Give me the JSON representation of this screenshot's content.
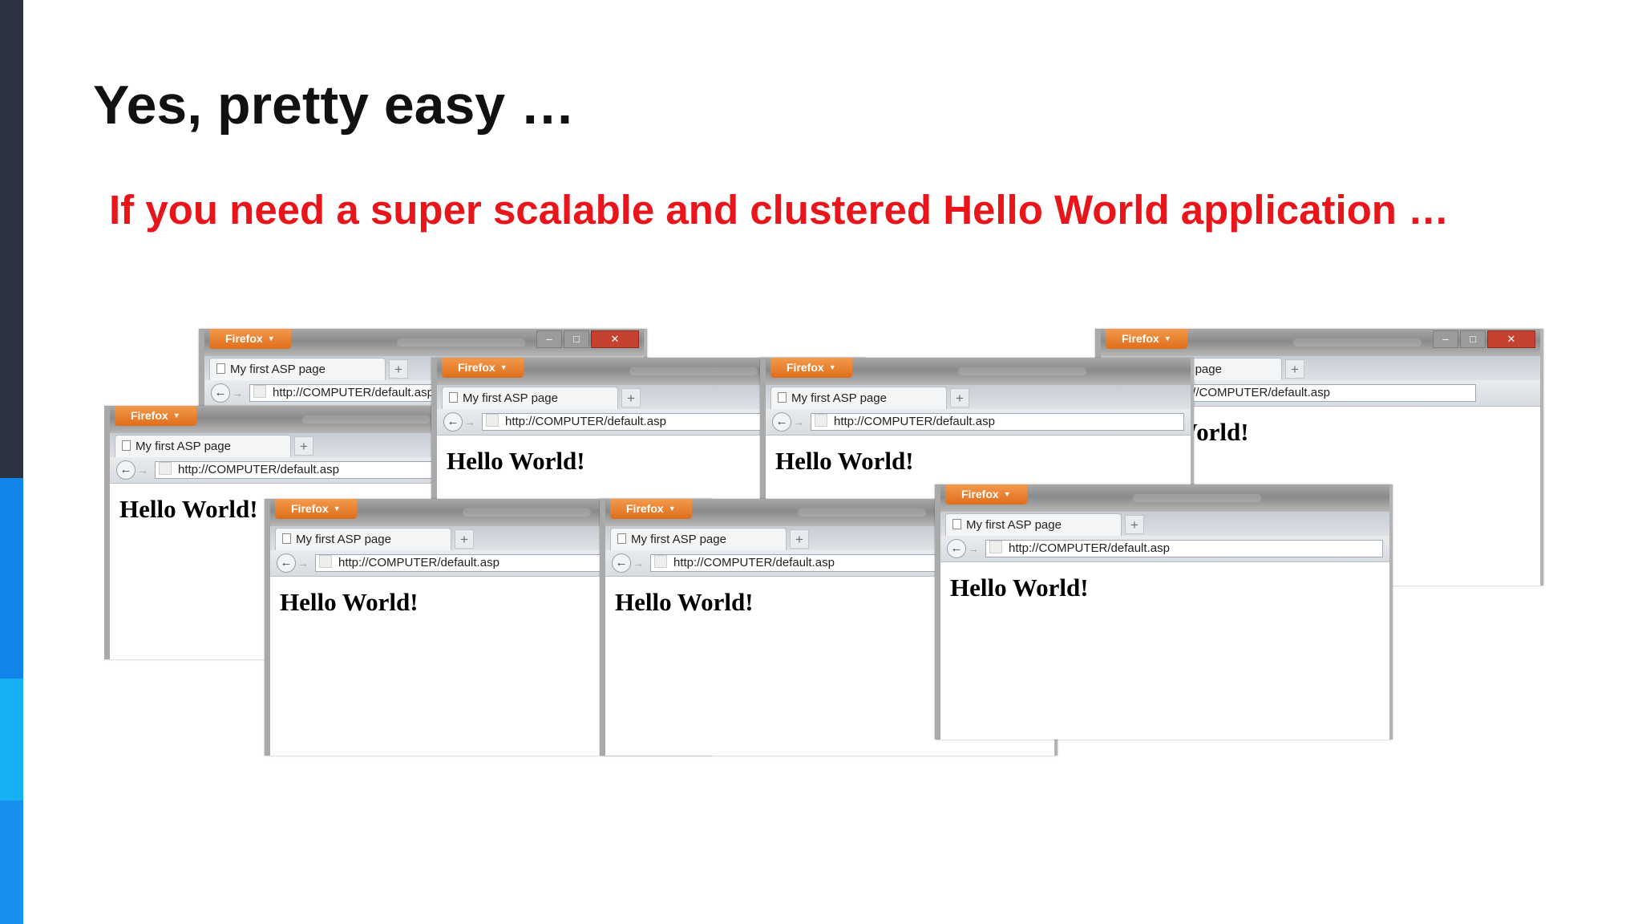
{
  "slide": {
    "title": "Yes, pretty easy …",
    "subtitle": "If you need a super scalable and clustered Hello World application …",
    "subtitle_color": "#e8151b",
    "accent_colors": [
      "#2b3241",
      "#1285ec",
      "#15b1f2",
      "#1a90ee"
    ]
  },
  "browser": {
    "menu_label": "Firefox",
    "tab_title": "My first ASP page",
    "url": "http://COMPUTER/default.asp",
    "heading": "Hello World!",
    "menu_color": "#e0761f",
    "icons": {
      "menu_caret": "caret-down-icon",
      "page": "page-icon",
      "new_tab": "plus-icon",
      "back": "back-arrow-icon",
      "forward": "forward-arrow-icon",
      "minimize": "minimize-icon",
      "maximize": "maximize-icon",
      "close": "close-icon"
    }
  }
}
